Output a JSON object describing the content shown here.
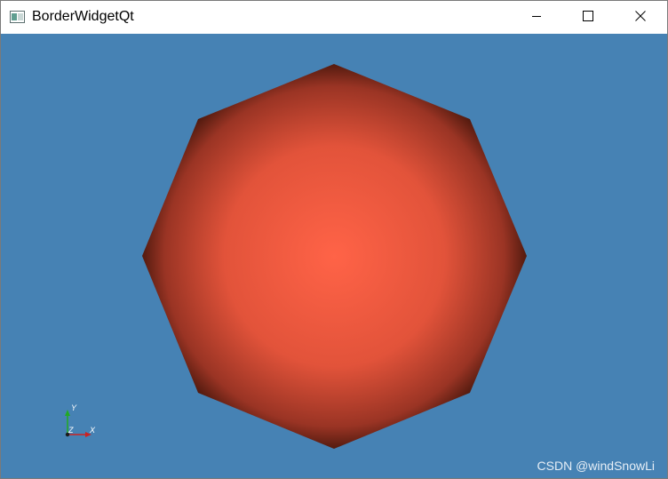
{
  "window": {
    "title": "BorderWidgetQt",
    "app_icon": "qt-window-icon",
    "controls": {
      "minimize_icon": "minimize-icon",
      "maximize_icon": "maximize-icon",
      "close_icon": "close-icon"
    }
  },
  "viewport": {
    "background_color": "#4682b4",
    "object": {
      "shape": "octagon",
      "center_color": "#ff6347",
      "edge_color": "#3a1208"
    },
    "axes": {
      "y_label": "Y",
      "z_label": "Z",
      "x_label": "X",
      "y_color": "#22aa22",
      "x_color": "#cc2222",
      "z_color": "#1a1a1a"
    },
    "watermark": "CSDN @windSnowLi"
  }
}
